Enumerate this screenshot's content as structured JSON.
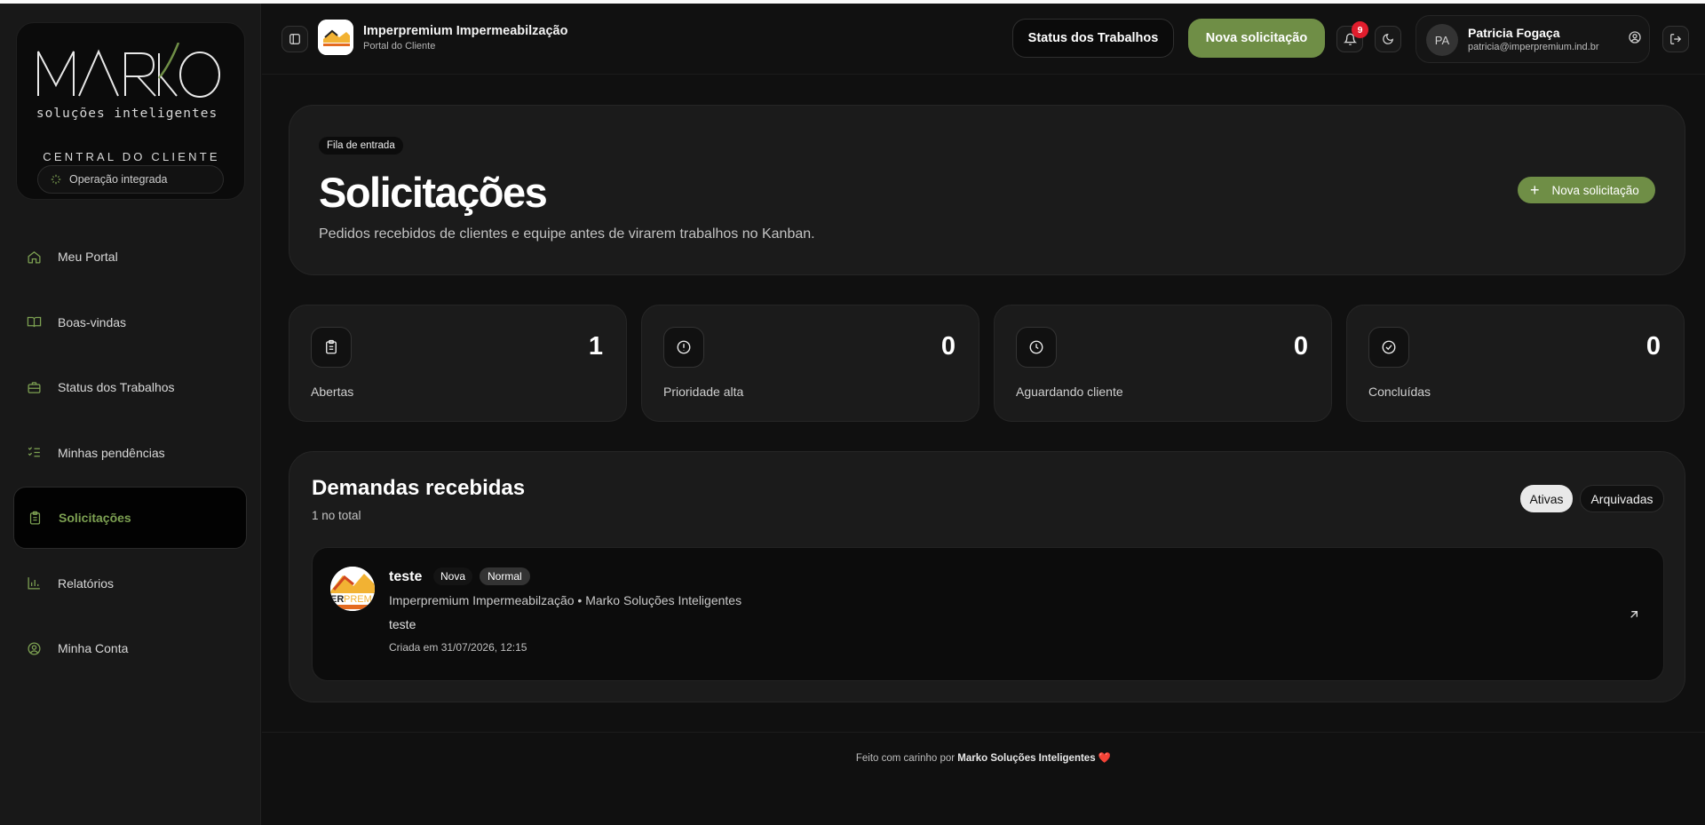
{
  "brand": {
    "logo_text": "MARKO",
    "logo_tagline": "soluções inteligentes",
    "center_label": "CENTRAL DO CLIENTE",
    "status_pill": "Operação integrada"
  },
  "sidebar": {
    "items": [
      {
        "label": "Meu Portal",
        "icon": "home-icon"
      },
      {
        "label": "Boas-vindas",
        "icon": "book-open-icon"
      },
      {
        "label": "Status dos Trabalhos",
        "icon": "briefcase-icon"
      },
      {
        "label": "Minhas pendências",
        "icon": "checklist-icon"
      },
      {
        "label": "Solicitações",
        "icon": "clipboard-icon",
        "active": true
      },
      {
        "label": "Relatórios",
        "icon": "bar-chart-icon"
      },
      {
        "label": "Minha Conta",
        "icon": "user-circle-icon"
      }
    ]
  },
  "header": {
    "company_name": "Imperpremium Impermeabilzação",
    "company_sub": "Portal do Cliente",
    "status_button": "Status dos Trabalhos",
    "new_button": "Nova solicitação",
    "notification_count": "9",
    "user_initials": "PA",
    "user_name": "Patricia Fogaça",
    "user_email": "patricia@imperpremium.ind.br"
  },
  "hero": {
    "chip": "Fila de entrada",
    "title": "Solicitações",
    "subtitle": "Pedidos recebidos de clientes e equipe antes de virarem trabalhos no Kanban.",
    "button": "Nova solicitação"
  },
  "stats": [
    {
      "value": "1",
      "label": "Abertas",
      "icon": "clipboard-icon"
    },
    {
      "value": "0",
      "label": "Prioridade alta",
      "icon": "alert-circle-icon"
    },
    {
      "value": "0",
      "label": "Aguardando cliente",
      "icon": "clock-icon"
    },
    {
      "value": "0",
      "label": "Concluídas",
      "icon": "check-circle-icon"
    }
  ],
  "demandas": {
    "title": "Demandas recebidas",
    "count": "1 no total",
    "tab_active": "Ativas",
    "tab_archived": "Arquivadas",
    "items": [
      {
        "title": "teste",
        "status": "Nova",
        "priority": "Normal",
        "meta": "Imperpremium Impermeabilzação • Marko Soluções Inteligentes",
        "description": "teste",
        "created": "Criada em 31/07/2026, 12:15"
      }
    ]
  },
  "footer": {
    "prefix": "Feito com carinho por",
    "brand": "Marko Soluções Inteligentes",
    "heart": "❤️"
  },
  "colors": {
    "accent": "#6f8e46",
    "accent_text": "#7da152",
    "background": "#101010",
    "card": "#1b1b1b",
    "badge": "#e11d2d"
  }
}
